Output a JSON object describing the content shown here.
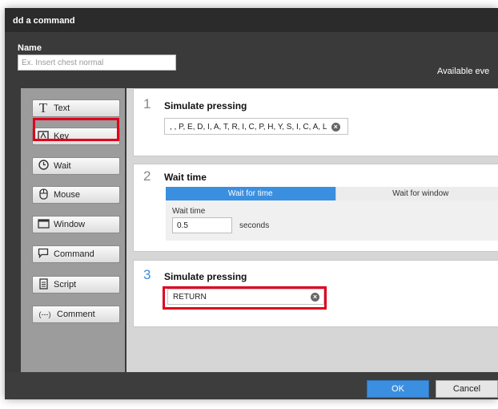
{
  "window": {
    "title": "dd a command"
  },
  "name_field": {
    "label": "Name",
    "placeholder": "Ex. Insert chest normal",
    "value": ""
  },
  "available_text": "Available eve",
  "sidebar": {
    "items": [
      {
        "label": "Text",
        "icon": "T"
      },
      {
        "label": "Key",
        "icon": "keyboard-icon"
      },
      {
        "label": "Wait",
        "icon": "clock-icon"
      },
      {
        "label": "Mouse",
        "icon": "mouse-icon"
      },
      {
        "label": "Window",
        "icon": "window-icon"
      },
      {
        "label": "Command",
        "icon": "speech-bubble-icon"
      },
      {
        "label": "Script",
        "icon": "document-icon"
      },
      {
        "label": "Comment",
        "icon": "(---)"
      }
    ]
  },
  "steps": [
    {
      "number": "1",
      "title": "Simulate pressing",
      "keys": ", , P, E, D, I, A, T, R, I, C, P, H, Y, S, I, C, A, L"
    },
    {
      "number": "2",
      "title": "Wait time",
      "tabs": [
        {
          "label": "Wait for time"
        },
        {
          "label": "Wait for window"
        }
      ],
      "wait_label": "Wait time",
      "wait_value": "0.5",
      "unit": "seconds"
    },
    {
      "number": "3",
      "title": "Simulate pressing",
      "keys": "RETURN"
    }
  ],
  "footer": {
    "ok_label": "OK",
    "cancel_label": "Cancel"
  },
  "colors": {
    "accent": "#3b8fe0",
    "highlight": "#e0001b",
    "sidebar": "#9c9c9c"
  }
}
